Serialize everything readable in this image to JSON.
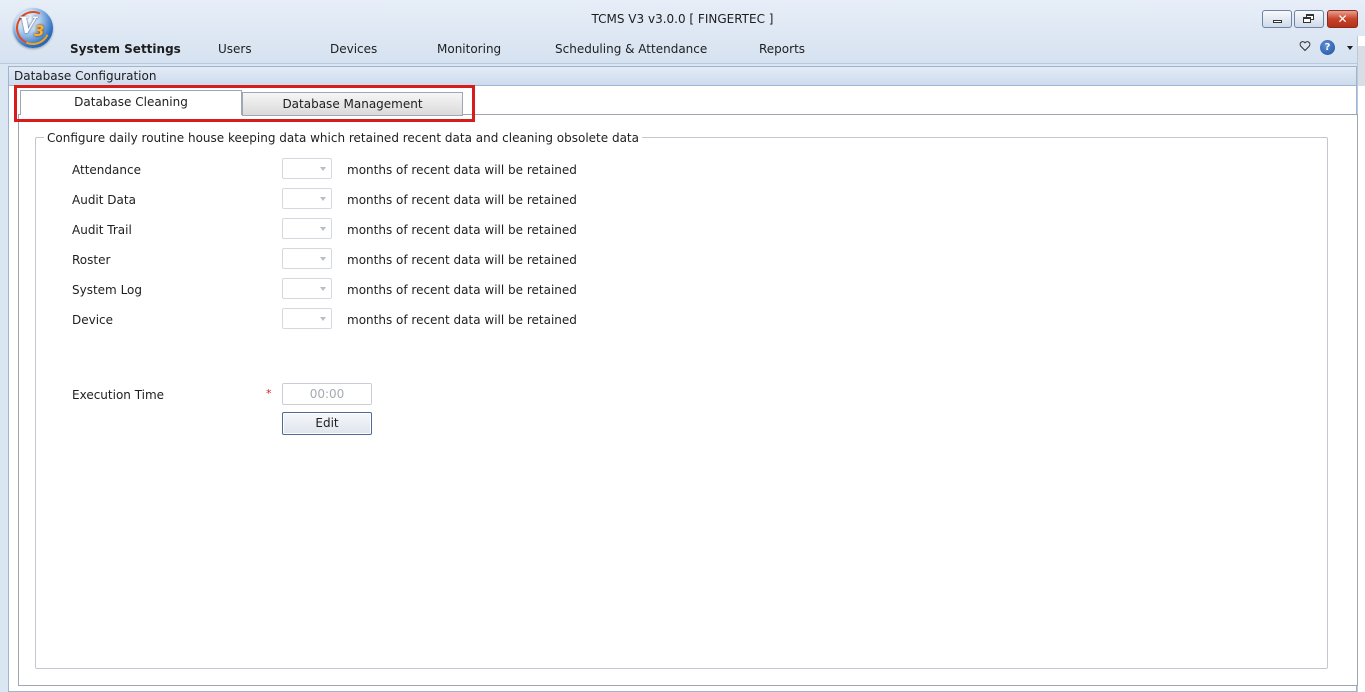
{
  "window": {
    "title": "TCMS V3 v3.0.0 [ FINGERTEC ]",
    "logo_text": "V3",
    "logo_letter": "V",
    "logo_number": "3"
  },
  "menu": {
    "items": [
      {
        "label": "System Settings",
        "active": true
      },
      {
        "label": "Users",
        "active": false
      },
      {
        "label": "Devices",
        "active": false
      },
      {
        "label": "Monitoring",
        "active": false
      },
      {
        "label": "Scheduling & Attendance",
        "active": false
      },
      {
        "label": "Reports",
        "active": false
      }
    ],
    "help_glyph": "?"
  },
  "section": {
    "title": "Database Configuration"
  },
  "tabs": [
    {
      "label": "Database Cleaning",
      "active": true
    },
    {
      "label": "Database Management",
      "active": false
    }
  ],
  "cleaning": {
    "legend": "Configure daily routine house keeping data which retained recent data and cleaning obsolete data",
    "rows": [
      {
        "label": "Attendance",
        "value": "",
        "suffix": "months of recent data will be retained"
      },
      {
        "label": "Audit Data",
        "value": "",
        "suffix": "months of recent data will be retained"
      },
      {
        "label": "Audit Trail",
        "value": "",
        "suffix": "months of recent data will be retained"
      },
      {
        "label": "Roster",
        "value": "",
        "suffix": "months of recent data will be retained"
      },
      {
        "label": "System Log",
        "value": "",
        "suffix": "months of recent data will be retained"
      },
      {
        "label": "Device",
        "value": "",
        "suffix": "months of recent data will be retained"
      }
    ],
    "execution_time": {
      "label": "Execution Time",
      "required_mark": "*",
      "placeholder": "00:00"
    },
    "edit_label": "Edit"
  },
  "colors": {
    "highlight": "#d71c1c",
    "chrome": "#dbe6f3",
    "required": "#d71c1c"
  },
  "icons": [
    "app-logo",
    "minimize-icon",
    "restore-icon",
    "close-icon",
    "heart-icon",
    "help-icon",
    "dropdown-arrow-icon"
  ]
}
